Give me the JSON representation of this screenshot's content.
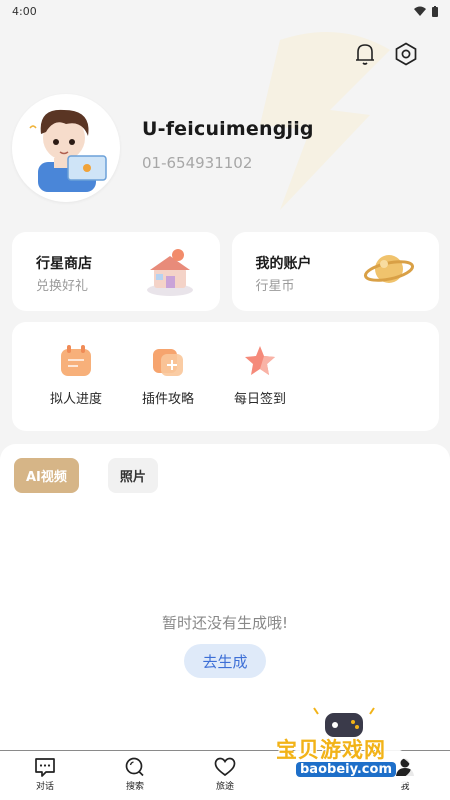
{
  "status_bar": {
    "time": "4:00"
  },
  "profile": {
    "username": "U-feicuimengjig",
    "user_id": "01-654931102"
  },
  "cards": [
    {
      "title": "行星商店",
      "subtitle": "兑换好礼",
      "icon": "gift-house-icon"
    },
    {
      "title": "我的账户",
      "subtitle": "行星币",
      "icon": "planet-icon"
    }
  ],
  "tools": [
    {
      "label": "拟人进度",
      "icon": "calendar-icon"
    },
    {
      "label": "插件攻略",
      "icon": "plugin-icon"
    },
    {
      "label": "每日签到",
      "icon": "star-icon"
    }
  ],
  "tabs": [
    {
      "label": "AI视频",
      "active": true
    },
    {
      "label": "照片",
      "active": false
    }
  ],
  "empty_state": {
    "message": "暂时还没有生成哦!",
    "button_label": "去生成"
  },
  "nav": [
    {
      "label": "对话",
      "icon": "chat-icon"
    },
    {
      "label": "搜索",
      "icon": "search-icon"
    },
    {
      "label": "旅途",
      "icon": "heart-icon"
    },
    {
      "label": "",
      "icon": "game-icon"
    },
    {
      "label": "我",
      "icon": "person-icon"
    }
  ],
  "watermark": {
    "text": "宝贝游戏网",
    "url": "baobeiy.com"
  },
  "colors": {
    "accent_gold": "#d6b587",
    "button_blue": "#3d6fd6",
    "background": "#f4f4f4"
  }
}
